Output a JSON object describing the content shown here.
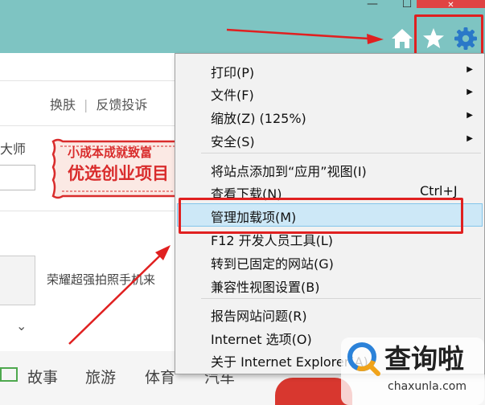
{
  "window": {
    "minimize": "—",
    "maximize": "☐",
    "close": "✕"
  },
  "toolbar": {
    "home_icon": "home-icon",
    "favorites_icon": "star-icon",
    "tools_icon": "gear-icon"
  },
  "page": {
    "header_links": [
      "换肤",
      "反馈投诉"
    ],
    "header_sep": "|",
    "dashi": "大师",
    "ad_line1": "小成本成就致富",
    "ad_line2": "优选创业项目",
    "honor": "荣耀超强拍照手机来",
    "expand": "⌄",
    "nav": [
      "故事",
      "旅游",
      "体育",
      "汽车"
    ]
  },
  "menu": {
    "items": [
      {
        "label": "打印(P)",
        "submenu": true
      },
      {
        "label": "文件(F)",
        "submenu": true
      },
      {
        "label": "缩放(Z) (125%)",
        "submenu": true
      },
      {
        "label": "安全(S)",
        "submenu": true
      },
      {
        "label": "将站点添加到“应用”视图(I)"
      },
      {
        "label": "查看下载(N)",
        "shortcut": "Ctrl+J"
      },
      {
        "label": "管理加载项(M)",
        "highlighted": true
      },
      {
        "label": "F12 开发人员工具(L)"
      },
      {
        "label": "转到已固定的网站(G)"
      },
      {
        "label": "兼容性视图设置(B)"
      },
      {
        "label": "报告网站问题(R)"
      },
      {
        "label": "Internet 选项(O)"
      },
      {
        "label": "关于 Internet Explorer(A)"
      }
    ],
    "submenu_arrow": "▶"
  },
  "watermark": {
    "text": "查询啦",
    "url": "chaxunla.com"
  },
  "colors": {
    "titlebar": "#7ec4c2",
    "menu_bg": "#f2f2f2",
    "highlight": "#cde8f7",
    "annotation_red": "#e02020"
  }
}
